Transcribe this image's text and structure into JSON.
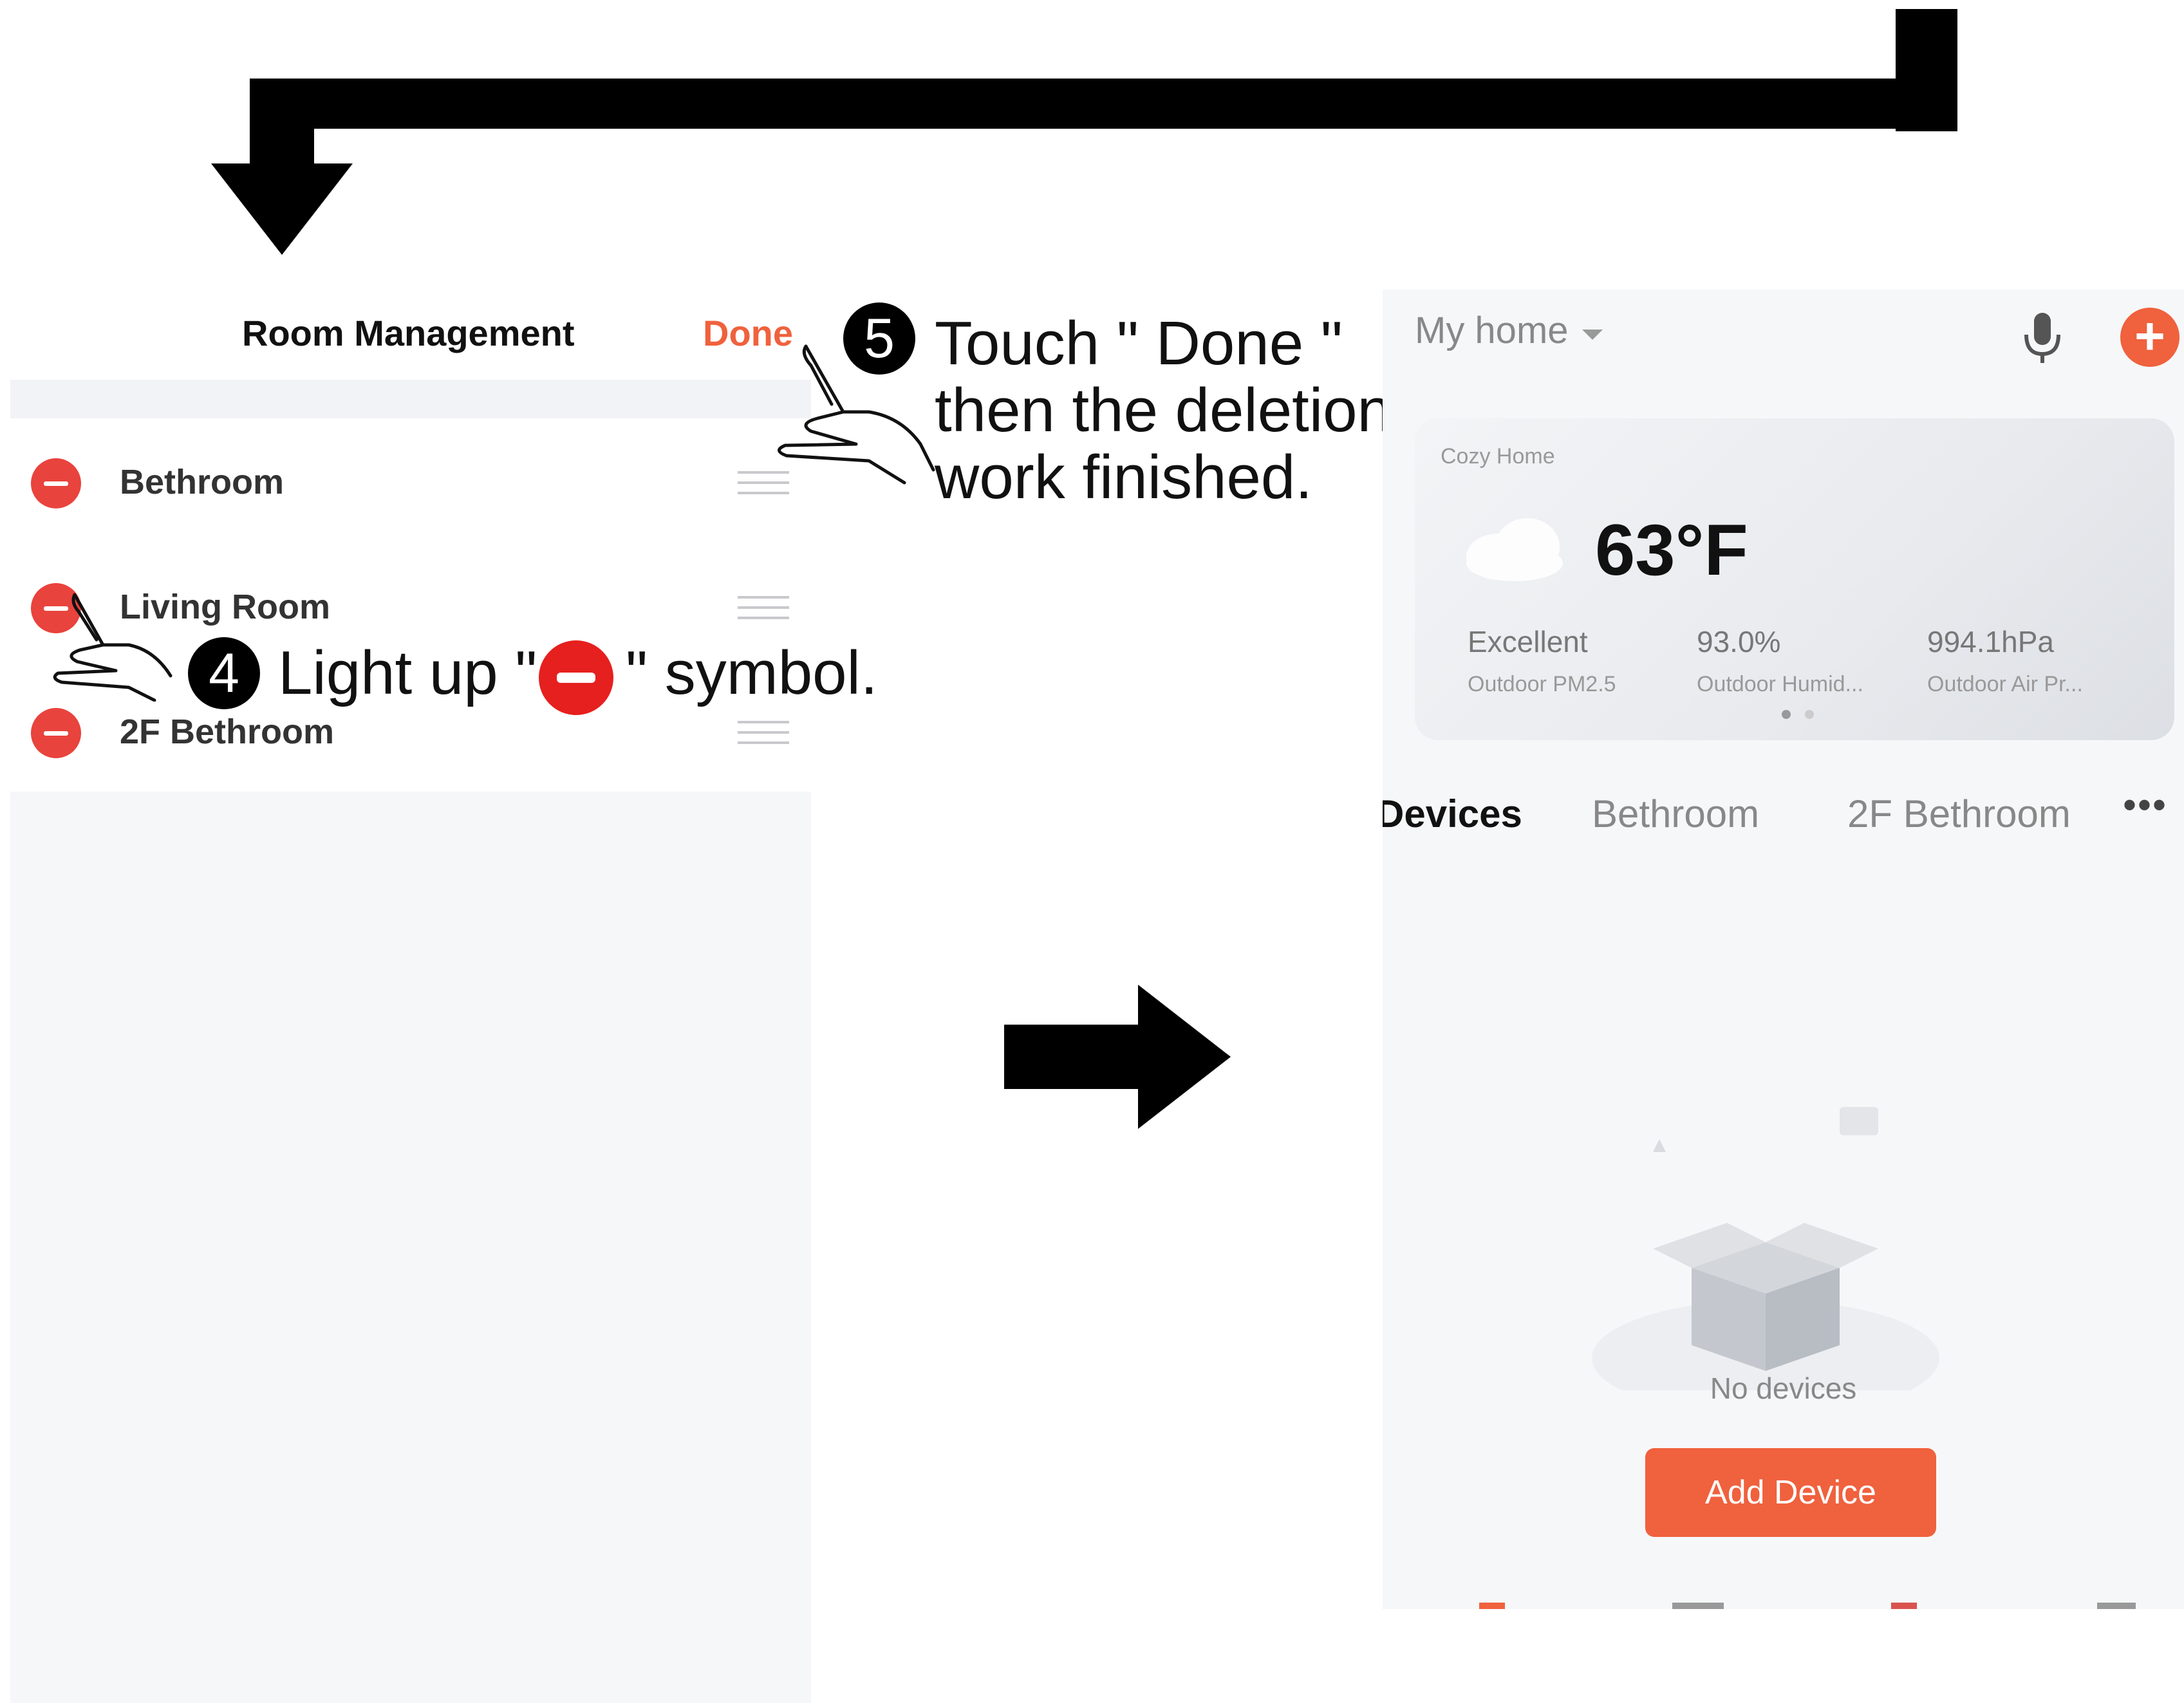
{
  "room_management": {
    "title": "Room Management",
    "done_label": "Done",
    "rooms": [
      {
        "name": "Bethroom"
      },
      {
        "name": "Living Room"
      },
      {
        "name": "2F Bethroom"
      }
    ]
  },
  "callouts": {
    "step4_number": "4",
    "step4_prefix": "Light up \"",
    "step4_suffix": "\" symbol.",
    "step5_number": "5",
    "step5_text": "Touch \" Done \"\nthen the deletion\nwork finished."
  },
  "home": {
    "title": "My home",
    "location": "Cozy Home",
    "temperature": "63°F",
    "metrics": [
      {
        "value": "Excellent",
        "label": "Outdoor PM2.5"
      },
      {
        "value": "93.0%",
        "label": "Outdoor Humid..."
      },
      {
        "value": "994.1hPa",
        "label": "Outdoor Air Pr..."
      }
    ],
    "tabs": [
      "Devices",
      "Bethroom",
      "2F Bethroom",
      "•••"
    ],
    "empty_text": "No devices",
    "add_device_label": "Add Device"
  },
  "colors": {
    "accent": "#f0613d",
    "delete": "#e9433d",
    "background": "#f6f7f9"
  },
  "icons": [
    "mic-icon",
    "add-icon",
    "cloud-icon",
    "minus-icon",
    "drag-handle-icon",
    "hand-pointer-icon",
    "chevron-down-icon"
  ]
}
